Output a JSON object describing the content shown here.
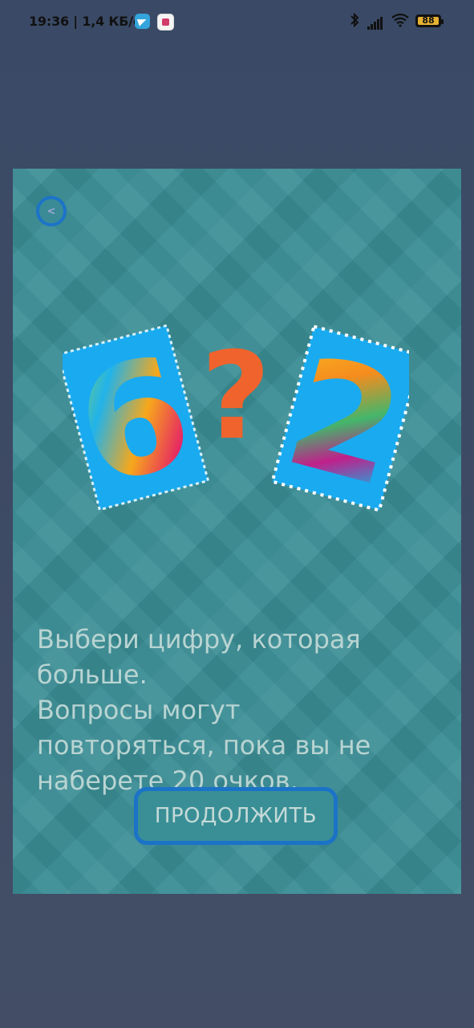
{
  "status_bar": {
    "time": "19:36 | 1,4 КБ/с",
    "battery_level": "88",
    "icons": [
      "telegram-icon",
      "app-notification-icon",
      "bluetooth-icon",
      "signal-icon",
      "wifi-icon",
      "battery-icon"
    ]
  },
  "card": {
    "back_button_label": "<",
    "illustration": {
      "left_digit": "6",
      "right_digit": "2",
      "question_mark": "?"
    },
    "instruction_lines": [
      "Выбери цифру, которая",
      "больше.",
      "Вопросы могут",
      "повторяться, пока вы не",
      "наберете 20 очков."
    ],
    "continue_label": "ПРОДОЛЖИТЬ"
  },
  "colors": {
    "accent_blue": "#1b73c8",
    "card_teal": "#3a8d95",
    "stamp_blue": "#18aeef",
    "question_orange": "#f0632c"
  }
}
